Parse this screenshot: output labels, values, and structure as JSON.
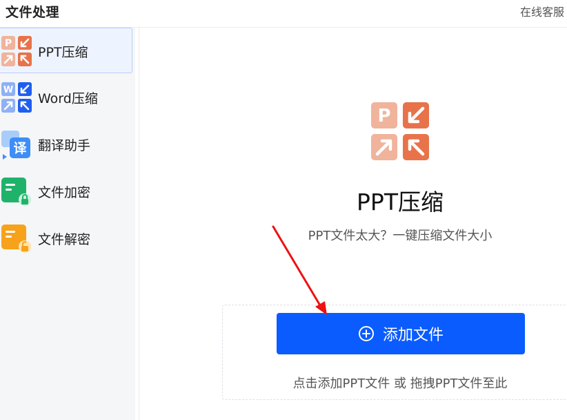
{
  "header": {
    "title": "文件处理",
    "service_label": "在线客服"
  },
  "sidebar": {
    "items": [
      {
        "label": "PPT压缩",
        "icon": "ppt-compress-icon",
        "active": true
      },
      {
        "label": "Word压缩",
        "icon": "word-compress-icon",
        "active": false
      },
      {
        "label": "翻译助手",
        "icon": "translate-icon",
        "active": false
      },
      {
        "label": "文件加密",
        "icon": "file-encrypt-icon",
        "active": false
      },
      {
        "label": "文件解密",
        "icon": "file-decrypt-icon",
        "active": false
      }
    ]
  },
  "main": {
    "icon": "ppt-compress-icon",
    "title": "PPT压缩",
    "subtitle": "PPT文件太大？一键压缩文件大小",
    "add_button_label": "添加文件",
    "add_button_icon": "plus-circle-icon",
    "drop_hint": "点击添加PPT文件 或 拖拽PPT文件至此"
  },
  "colors": {
    "accent": "#0b5cff",
    "ppt_light": "#f0b39c",
    "ppt_dark": "#e8734a",
    "word_light": "#8fb0f5",
    "word_dark": "#1f5ef0",
    "translate": "#3e8ef7",
    "encrypt": "#1fb36a",
    "decrypt": "#f7a21b",
    "annotation_arrow": "#ee1111"
  }
}
